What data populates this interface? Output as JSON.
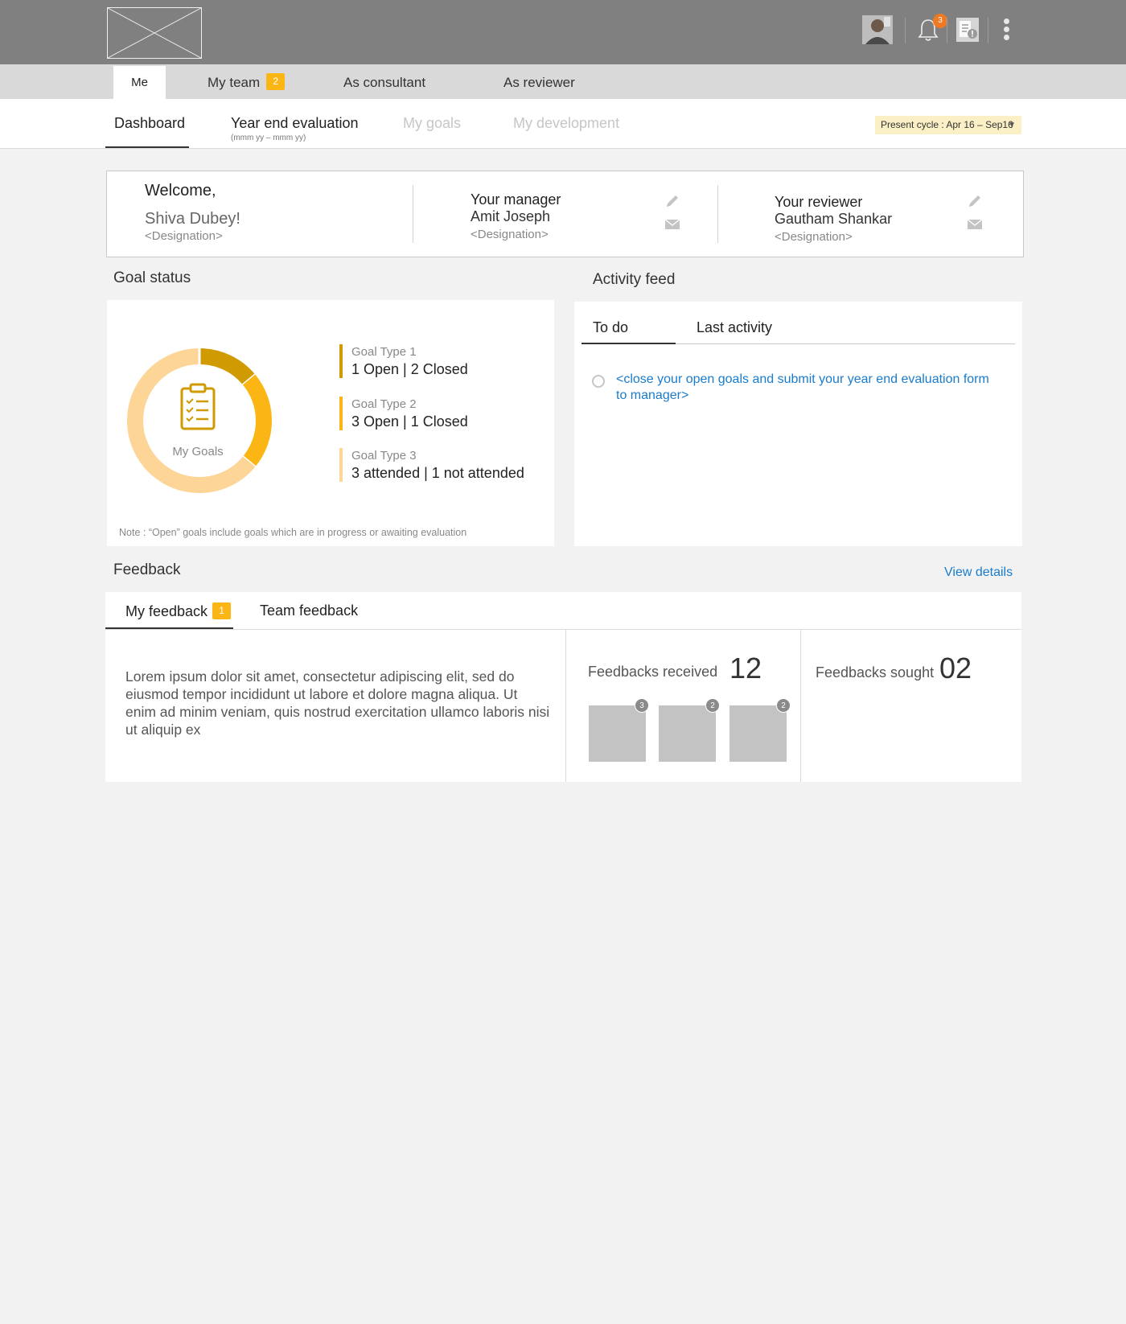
{
  "header": {
    "notification_count": "3"
  },
  "nav": {
    "primary_tabs": [
      {
        "label": "Me"
      },
      {
        "label": "My team",
        "badge": "2"
      },
      {
        "label": "As consultant"
      },
      {
        "label": "As reviewer"
      }
    ],
    "secondary_tabs": [
      {
        "label": "Dashboard"
      },
      {
        "label": "Year end evaluation",
        "sub": "(mmm yy – mmm yy)"
      },
      {
        "label": "My goals"
      },
      {
        "label": "My development"
      }
    ],
    "cycle_selector": "Present cycle : Apr 16 – Sep16"
  },
  "welcome": {
    "greeting": "Welcome,",
    "user_name": "Shiva Dubey!",
    "user_designation": "<Designation>",
    "manager_label": "Your manager",
    "manager_name": "Amit Joseph",
    "manager_designation": "<Designation>",
    "reviewer_label": "Your reviewer",
    "reviewer_name": "Gautham Shankar",
    "reviewer_designation": "<Designation>"
  },
  "goal_status": {
    "heading": "Goal status",
    "center_label": "My Goals",
    "entries": [
      {
        "type": "Goal Type 1",
        "value": "1 Open | 2 Closed",
        "color": "#d09a02"
      },
      {
        "type": "Goal Type 2",
        "value": "3 Open | 1 Closed",
        "color": "#fbb615"
      },
      {
        "type": "Goal Type 3",
        "value": "3 attended | 1 not attended",
        "color": "#fdd597"
      }
    ],
    "note": "Note : “Open” goals include goals which are in progress or awaiting evaluation",
    "donut_fractions": [
      0.14,
      0.22,
      0.64
    ]
  },
  "activity_feed": {
    "heading": "Activity feed",
    "tabs": [
      "To do",
      "Last activity"
    ],
    "todo_item": "<close your open goals and submit your year end evaluation form to manager>"
  },
  "feedback": {
    "heading": "Feedback",
    "view_details": "View details",
    "tabs": [
      {
        "label": "My feedback",
        "badge": "1"
      },
      {
        "label": "Team feedback"
      }
    ],
    "body_text": "Lorem ipsum dolor sit amet, consectetur adipiscing elit, sed do eiusmod tempor incididunt ut labore et dolore magna aliqua. Ut enim ad minim veniam, quis nostrud exercitation ullamco laboris nisi ut aliquip ex",
    "received_label": "Feedbacks received",
    "received_count": "12",
    "thumb_badges": [
      "3",
      "2",
      "2"
    ],
    "sought_label": "Feedbacks sought",
    "sought_count": "02"
  },
  "colors": {
    "accent_blue": "#1a7ccc",
    "badge_yellow": "#fbb615",
    "notification_orange": "#f07a24",
    "header_gray": "#808080"
  }
}
